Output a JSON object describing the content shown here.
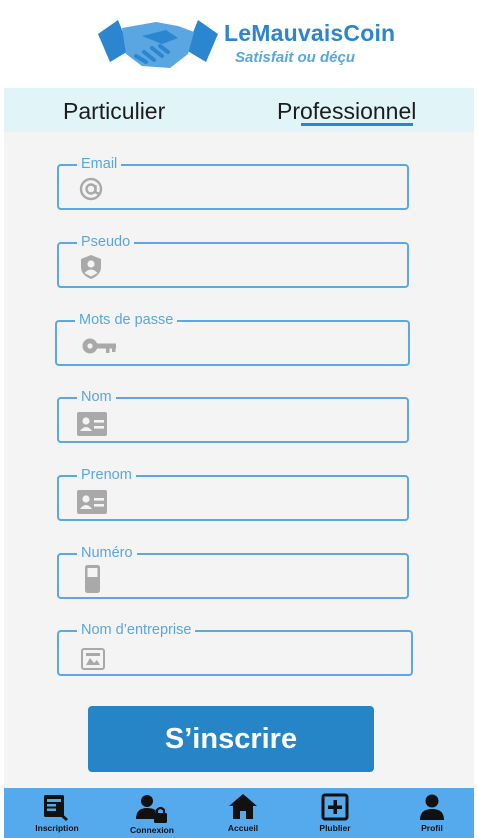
{
  "brand": {
    "name": "LeMauvaisCoin",
    "tagline": "Satisfait ou déçu"
  },
  "tabs": [
    {
      "label": "Particulier"
    },
    {
      "label": "Professionnel",
      "active": true
    }
  ],
  "form": {
    "fields": [
      {
        "label": "Email",
        "icon": "at-icon",
        "value": ""
      },
      {
        "label": "Pseudo",
        "icon": "shield-user-icon",
        "value": ""
      },
      {
        "label": "Mots de passe",
        "icon": "key-icon",
        "value": ""
      },
      {
        "label": "Nom",
        "icon": "id-card-icon",
        "value": ""
      },
      {
        "label": "Prenom",
        "icon": "id-card-icon",
        "value": ""
      },
      {
        "label": "Numéro",
        "icon": "phone-icon",
        "value": ""
      },
      {
        "label": "Nom d’entreprise",
        "icon": "image-icon",
        "value": ""
      }
    ],
    "submit_label": "S’inscrire"
  },
  "nav": [
    {
      "label": "Inscription",
      "icon": "register-icon"
    },
    {
      "label": "Connexion",
      "icon": "user-lock-icon"
    },
    {
      "label": "Accueil",
      "icon": "home-icon"
    },
    {
      "label": "Plublier",
      "icon": "add-box-icon"
    },
    {
      "label": "Profil",
      "icon": "person-icon"
    }
  ],
  "colors": {
    "accent": "#2585c7",
    "field_border": "#5aa8e8",
    "tab_bar": "#e1f5f8",
    "nav_bar": "#55a9ed"
  }
}
